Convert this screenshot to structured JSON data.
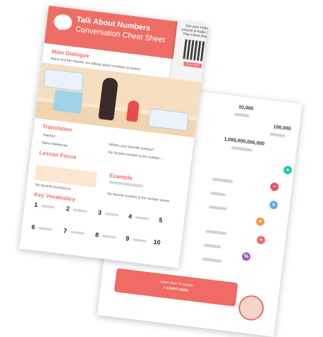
{
  "sheet": {
    "title": "Talk About Numbers",
    "subtitle": "Conversation Cheat Sheet",
    "ribbon_text": "Get your Video Lesson & Audio For This Cheat Sheet",
    "scan_label": "SCAN HERE",
    "sections": {
      "main_dialogue": "Main Dialogue",
      "main_dialogue_desc": "Nana and her teacher are talking about numbers at school.",
      "translation": "Translation",
      "teacher": "Teacher:",
      "student": "Nana Nakamura:",
      "translation_line1": "What's your favorite number?",
      "translation_line2": "My favorite number is the number ...",
      "lesson_focus": "Lesson Focus",
      "lesson_focus_line": "My favorite [number] is...",
      "example": "Example",
      "example_line": "My favorite number is the number seven.",
      "key_vocabulary": "Key Vocabulary"
    },
    "vocab_numbers": [
      "1",
      "2",
      "3",
      "4",
      "5",
      "6",
      "7",
      "8",
      "9",
      "10"
    ]
  },
  "back": {
    "numbers": [
      "10,000",
      "100,000",
      "1,000,000,000,000"
    ],
    "operators": [
      {
        "symbol": "+",
        "color": "#2cc4b8"
      },
      {
        "symbol": "−",
        "color": "#e8555e"
      },
      {
        "symbol": "=",
        "color": "#6fa8dc"
      },
      {
        "symbol": "×",
        "color": "#f39c3d"
      },
      {
        "symbol": "÷",
        "color": "#ee6e66"
      },
      {
        "symbol": "%",
        "color": "#9b59b6"
      }
    ],
    "cta_line1": "Learn How To Create",
    "cta_line2": "> START HERE"
  }
}
